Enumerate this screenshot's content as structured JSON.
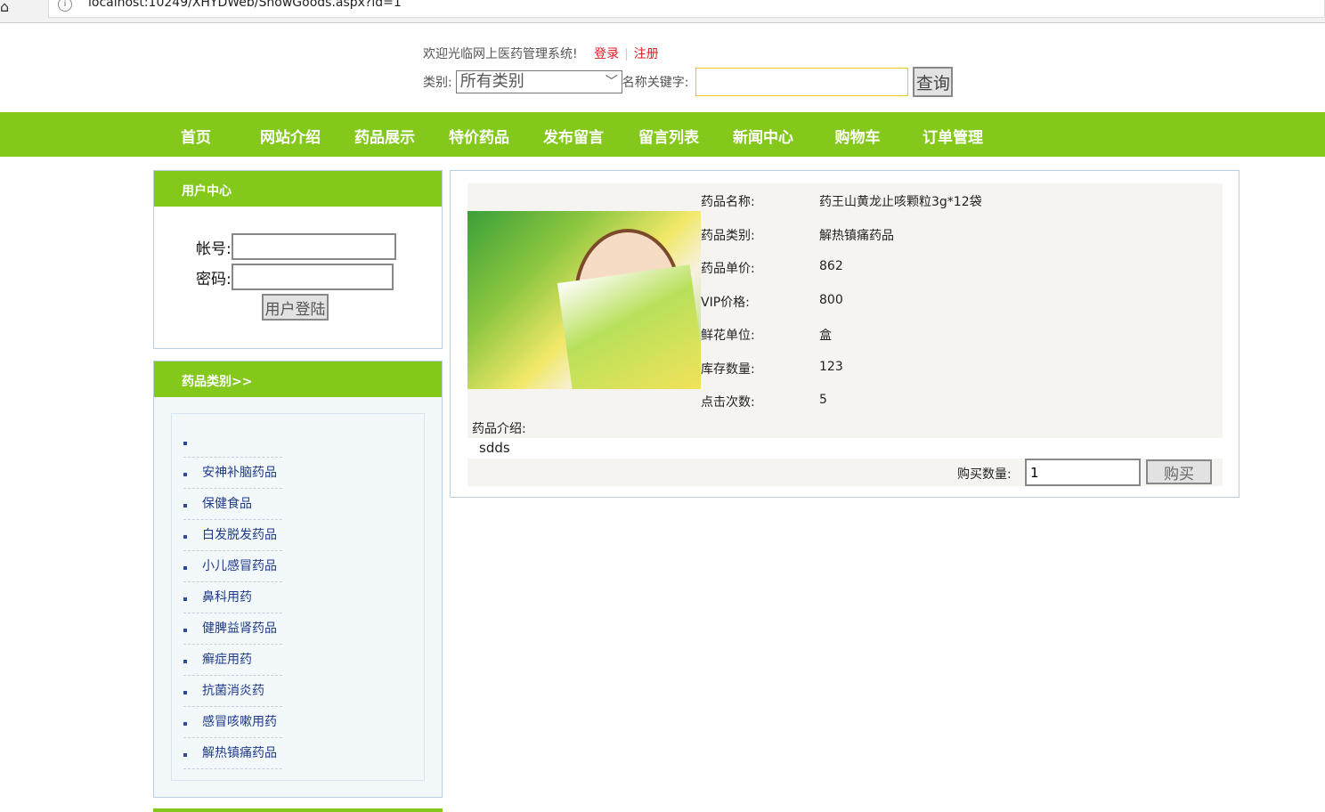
{
  "browser": {
    "url": "localhost:10249/XHYDWeb/ShowGoods.aspx?id=1"
  },
  "header": {
    "welcome": "欢迎光临网上医药管理系统!",
    "login": "登录",
    "sep": "|",
    "register": "注册",
    "category_label": "类别:",
    "category_value": "所有类别",
    "keyword_label": "名称关键字:",
    "keyword_value": "",
    "search_button": "查询"
  },
  "nav": [
    "首页",
    "网站介绍",
    "药品展示",
    "特价药品",
    "发布留言",
    "留言列表",
    "新闻中心",
    "购物车",
    "订单管理"
  ],
  "user_center": {
    "title": "用户中心",
    "account_label": "帐号:",
    "password_label": "密码:",
    "login_button": "用户登陆"
  },
  "categories": {
    "title": "药品类别>>",
    "items": [
      "",
      "安神补脑药品",
      "保健食品",
      "白发脱发药品",
      "小儿感冒药品",
      "鼻科用药",
      "健脾益肾药品",
      "癣症用药",
      "抗菌消炎药",
      "感冒咳嗽用药",
      "解热镇痛药品"
    ]
  },
  "product": {
    "fields": [
      {
        "label": "药品名称:",
        "value": "药王山黄龙止咳颗粒3g*12袋"
      },
      {
        "label": "药品类别:",
        "value": "解热镇痛药品"
      },
      {
        "label": "药品单价:",
        "value": "862"
      },
      {
        "label": "VIP价格:",
        "value": "800"
      },
      {
        "label": "鲜花单位:",
        "value": "盒"
      },
      {
        "label": "库存数量:",
        "value": "123"
      },
      {
        "label": "点击次数:",
        "value": "5"
      }
    ],
    "intro_label": "药品介绍:",
    "intro": "sdds",
    "qty_label": "购买数量:",
    "qty": "1",
    "buy_button": "购买"
  }
}
